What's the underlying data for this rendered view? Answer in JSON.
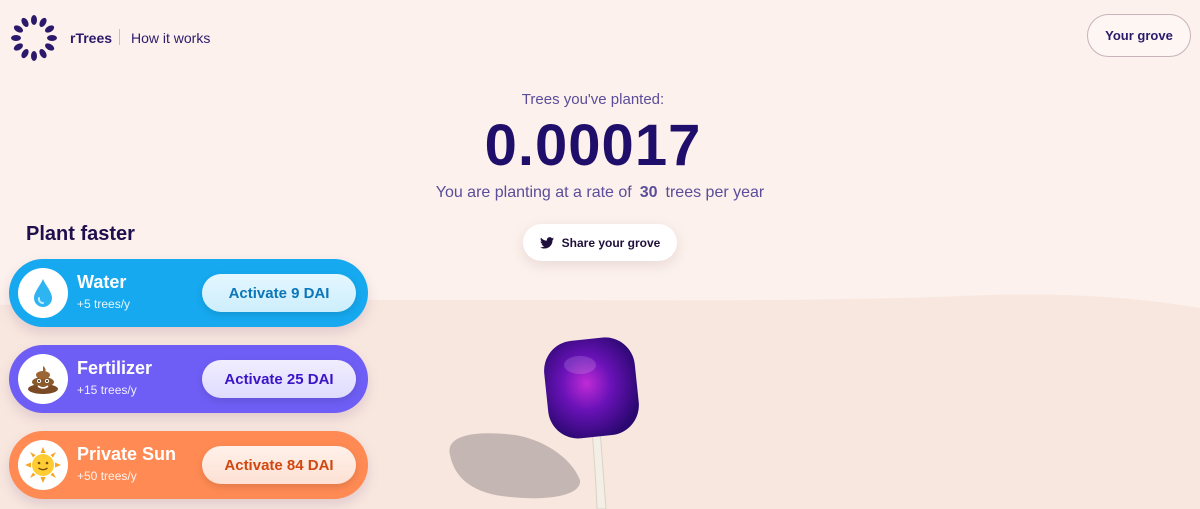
{
  "header": {
    "brand": "rTrees",
    "nav_link": "How it works",
    "grove_button": "Your grove"
  },
  "stats": {
    "label": "Trees you've planted:",
    "count": "0.00017",
    "rate_prefix": "You are planting at a rate of",
    "rate_value": "30",
    "rate_suffix": "trees per year"
  },
  "share": {
    "label": "Share your grove",
    "icon": "twitter-icon"
  },
  "boosts": {
    "title": "Plant faster",
    "items": [
      {
        "name": "Water",
        "rate": "+5 trees/y",
        "action": "Activate 9 DAI",
        "icon": "water-drop-icon",
        "color": "#16a9f0"
      },
      {
        "name": "Fertilizer",
        "rate": "+15 trees/y",
        "action": "Activate 25 DAI",
        "icon": "poop-icon",
        "color": "#6f5ef5"
      },
      {
        "name": "Private Sun",
        "rate": "+50 trees/y",
        "action": "Activate 84 DAI",
        "icon": "sun-icon",
        "color": "#ff8a53"
      }
    ]
  },
  "colors": {
    "background": "#fcf1ec",
    "primary_text": "#1f0f6b",
    "tree_crown": "#4a10a8"
  }
}
